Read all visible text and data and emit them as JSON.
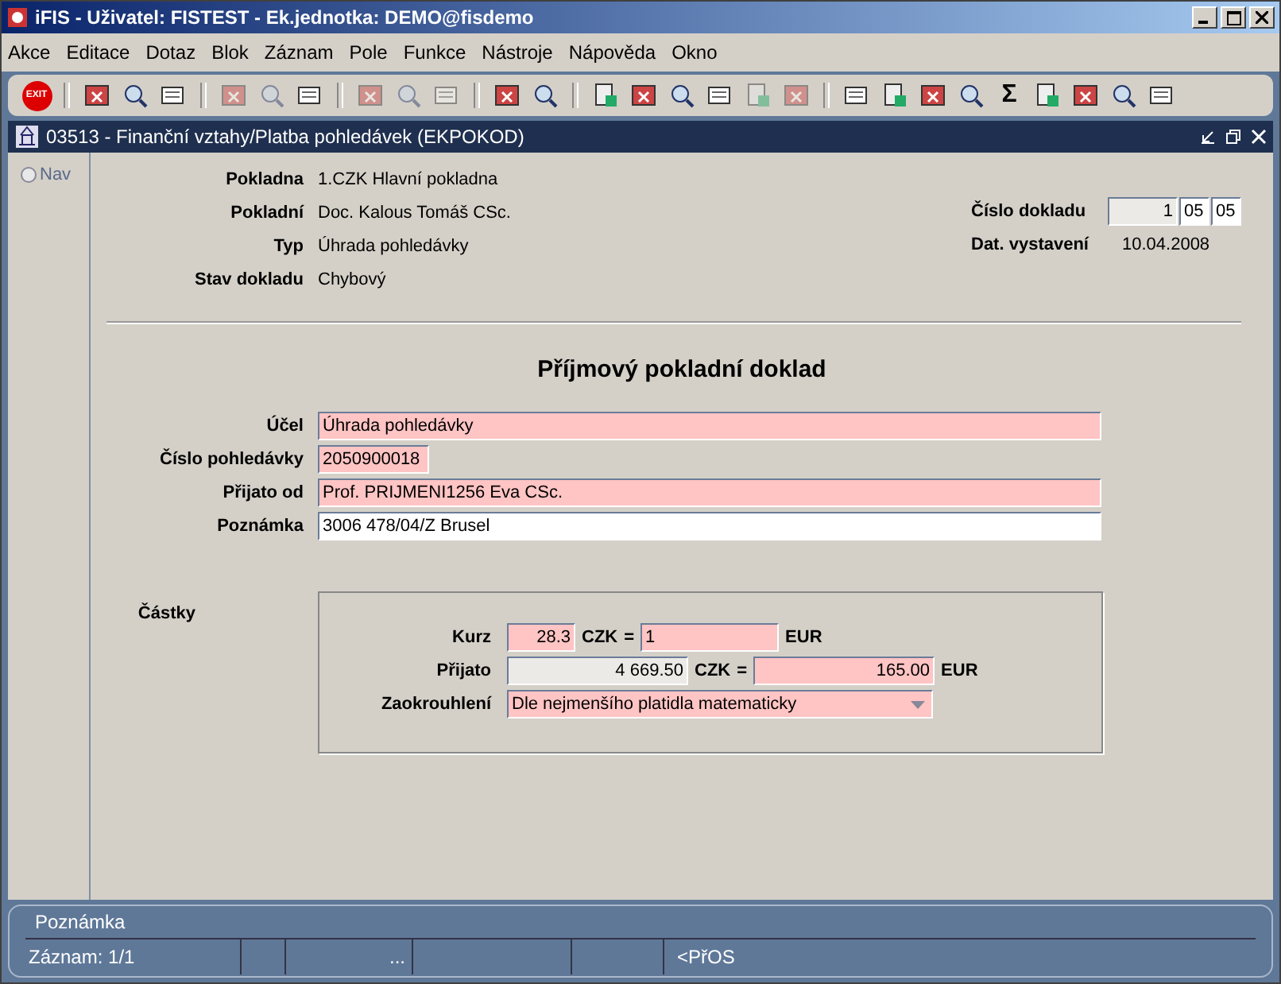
{
  "window": {
    "title": "iFIS - Uživatel: FISTEST - Ek.jednotka: DEMO@fisdemo"
  },
  "menu": [
    "Akce",
    "Editace",
    "Dotaz",
    "Blok",
    "Záznam",
    "Pole",
    "Funkce",
    "Nástroje",
    "Nápověda",
    "Okno"
  ],
  "toolbar": [
    {
      "kind": "exit",
      "text": "EXIT"
    },
    {
      "kind": "separator"
    },
    {
      "kind": "icon"
    },
    {
      "kind": "icon"
    },
    {
      "kind": "icon"
    },
    {
      "kind": "separator"
    },
    {
      "kind": "icon",
      "disabled": true
    },
    {
      "kind": "icon",
      "disabled": true
    },
    {
      "kind": "icon"
    },
    {
      "kind": "separator"
    },
    {
      "kind": "icon",
      "disabled": true
    },
    {
      "kind": "icon",
      "disabled": true
    },
    {
      "kind": "icon",
      "disabled": true
    },
    {
      "kind": "separator"
    },
    {
      "kind": "icon"
    },
    {
      "kind": "icon"
    },
    {
      "kind": "separator"
    },
    {
      "kind": "icon"
    },
    {
      "kind": "icon"
    },
    {
      "kind": "icon"
    },
    {
      "kind": "icon"
    },
    {
      "kind": "icon",
      "disabled": true
    },
    {
      "kind": "icon",
      "disabled": true
    },
    {
      "kind": "separator"
    },
    {
      "kind": "icon"
    },
    {
      "kind": "icon"
    },
    {
      "kind": "icon"
    },
    {
      "kind": "icon"
    },
    {
      "kind": "glyph",
      "text": "Σ"
    },
    {
      "kind": "icon"
    },
    {
      "kind": "icon"
    },
    {
      "kind": "icon"
    },
    {
      "kind": "icon"
    }
  ],
  "form_window": {
    "title": "03513 - Finanční vztahy/Platba pohledávek (EKPOKOD)"
  },
  "nav": {
    "label": "Nav",
    "selected": false
  },
  "header": [
    {
      "label": "Pokladna",
      "value": "1.CZK Hlavní pokladna"
    },
    {
      "label": "Pokladní",
      "value": "Doc. Kalous Tomáš CSc."
    },
    {
      "label": "Typ",
      "value": "Úhrada pohledávky"
    },
    {
      "label": "Stav dokladu",
      "value": "Chybový"
    }
  ],
  "doc_number": {
    "label": "Číslo dokladu",
    "parts": [
      "1",
      "05",
      "05"
    ]
  },
  "issue_date": {
    "label": "Dat. vystavení",
    "value": "10.04.2008"
  },
  "heading": "Příjmový pokladní doklad",
  "fields": [
    {
      "label": "Účel",
      "value": "Úhrada pohledávky",
      "kind": "required"
    },
    {
      "label": "Číslo pohledávky",
      "value": "2050900018",
      "kind": "required"
    },
    {
      "label": "Přijato od",
      "value": "Prof. PRIJMENI1256 Eva CSc.",
      "kind": "required"
    },
    {
      "label": "Poznámka",
      "value": "3006 478/04/Z Brusel",
      "kind": "normal"
    }
  ],
  "amounts": {
    "title": "Částky",
    "rows": [
      {
        "label": "Kurz",
        "left": {
          "value": "28.3",
          "kind": "required"
        },
        "unit": "CZK",
        "eq": "=",
        "right": {
          "value": "1",
          "kind": "required"
        },
        "unit2": "EUR"
      },
      {
        "label": "Přijato",
        "left": {
          "value": "4 669.50",
          "kind": "readonly"
        },
        "unit": "CZK",
        "eq": "=",
        "right": {
          "value": "165.00",
          "kind": "required"
        },
        "unit2": "EUR"
      }
    ],
    "rounding": {
      "label": "Zaokrouhlení",
      "value": "Dle nejmenšího platidla matematicky",
      "kind": "required"
    }
  },
  "status": {
    "hint": "Poznámka",
    "record": "Záznam: 1/1",
    "dots": "...",
    "mode": "<PřOS"
  }
}
